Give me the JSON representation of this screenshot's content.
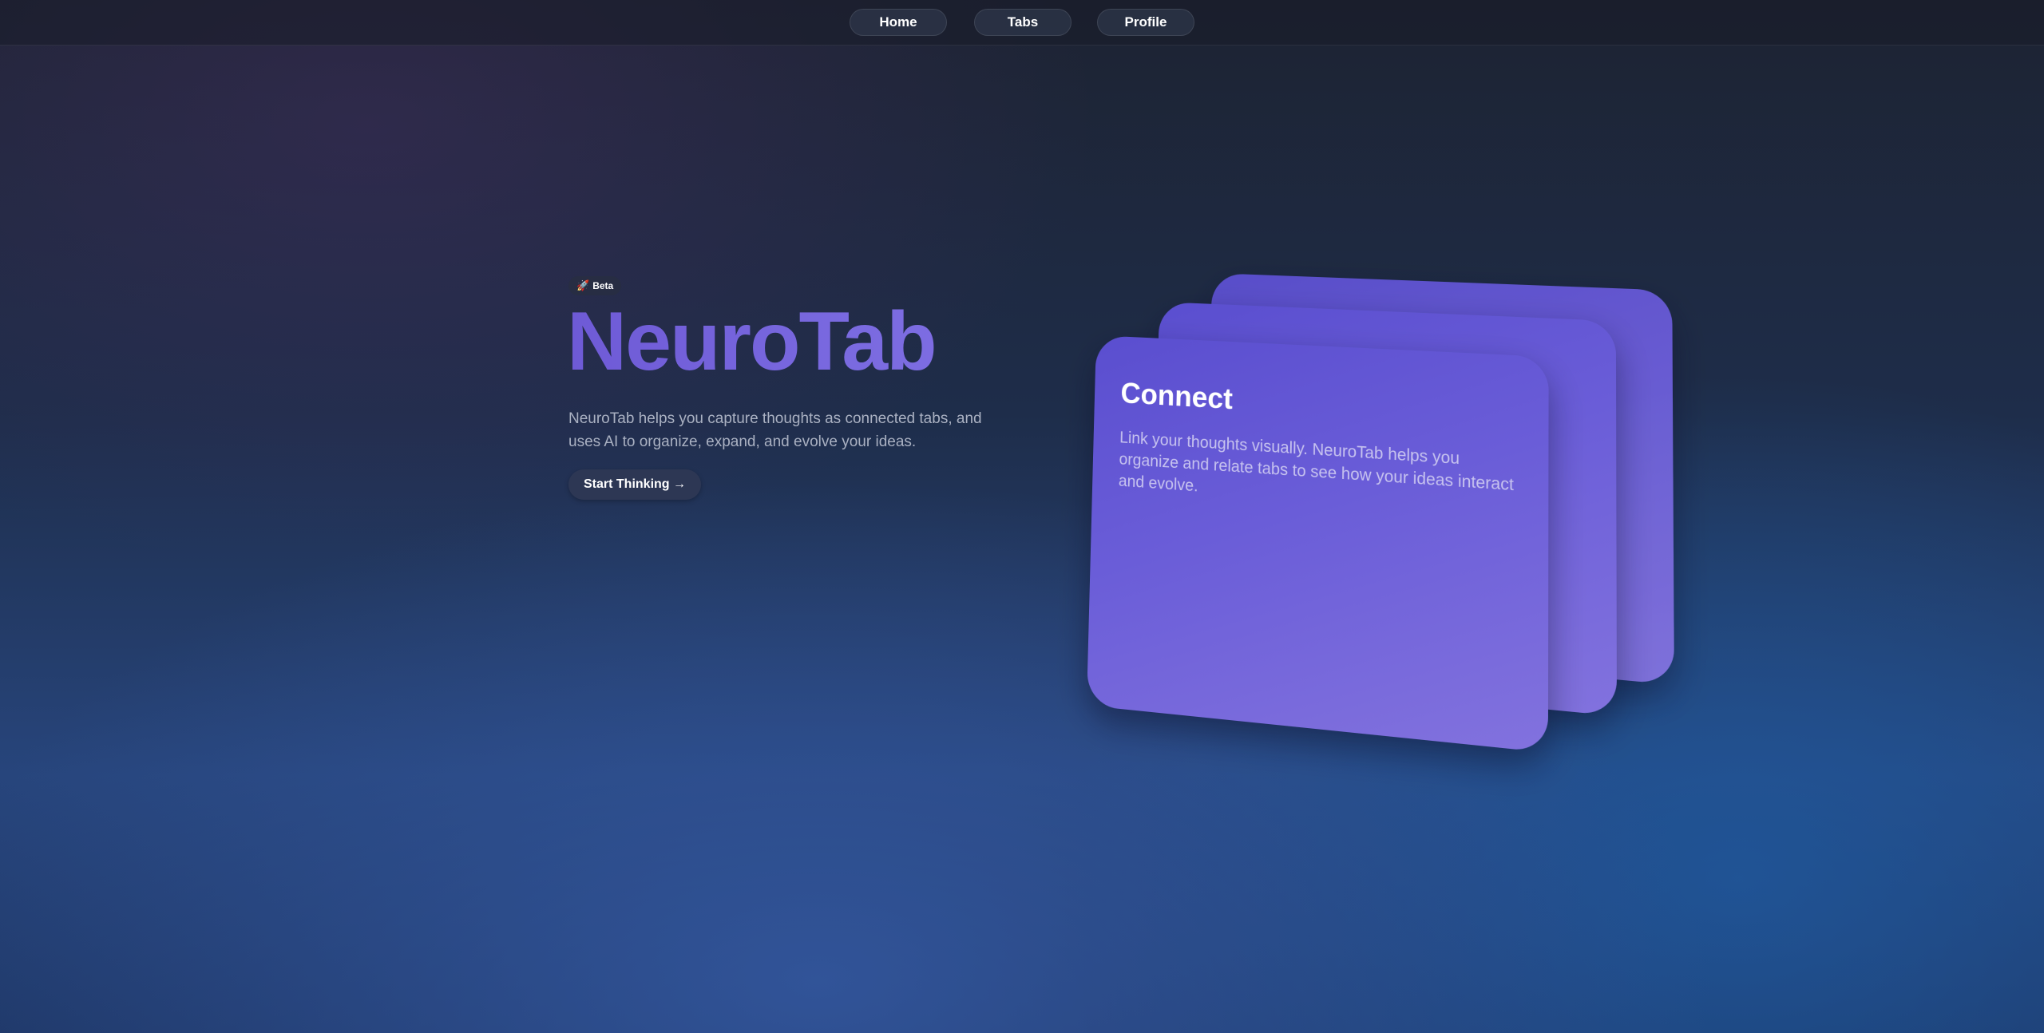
{
  "nav": {
    "items": [
      {
        "label": "Home"
      },
      {
        "label": "Tabs"
      },
      {
        "label": "Profile"
      }
    ]
  },
  "hero": {
    "badge_icon": "rocket-icon",
    "badge_label": "Beta",
    "title": "NeuroTab",
    "description": "NeuroTab helps you capture thoughts as connected tabs, and uses AI to organize, expand, and evolve your ideas.",
    "cta_label": "Start Thinking →"
  },
  "card": {
    "title": "Connect",
    "text": "Link your thoughts visually. NeuroTab helps you organize and relate tabs to see how your ideas interact and evolve."
  },
  "colors": {
    "accent": "#6e5ad6",
    "card": "#6a5dd8",
    "background": "#1e2d4a"
  }
}
